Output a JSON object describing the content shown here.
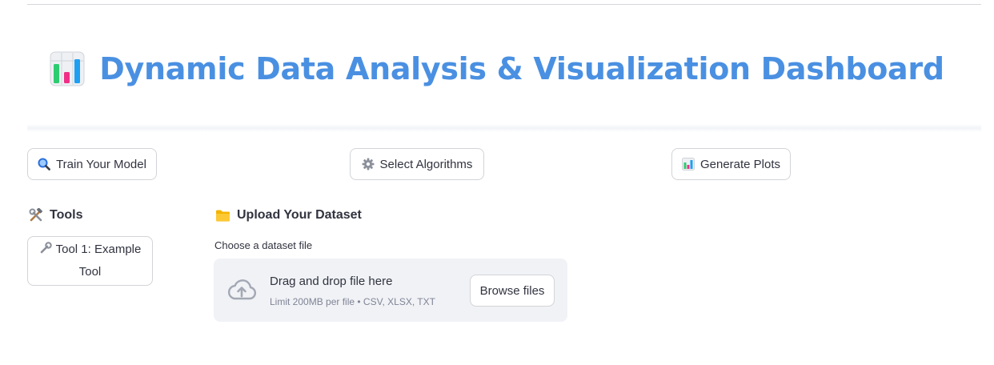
{
  "header": {
    "title": "Dynamic Data Analysis & Visualization Dashboard",
    "title_icon": "bar-chart-icon",
    "title_color": "#4a90e2"
  },
  "actions": [
    {
      "label": "Train Your Model",
      "icon": "magnifier-icon"
    },
    {
      "label": "Select Algorithms",
      "icon": "gear-icon"
    },
    {
      "label": "Generate Plots",
      "icon": "bar-chart-icon"
    }
  ],
  "sidebar": {
    "heading": "Tools",
    "heading_icon": "hammer-wrench-icon",
    "tools": [
      {
        "label": "Tool 1: Example Tool",
        "icon": "wrench-icon"
      }
    ]
  },
  "upload": {
    "heading": "Upload Your Dataset",
    "heading_icon": "folder-icon",
    "label": "Choose a dataset file",
    "drop_text": "Drag and drop file here",
    "limit_text": "Limit 200MB per file • CSV, XLSX, TXT",
    "browse_label": "Browse files",
    "dropzone_color": "#f0f2f6"
  }
}
